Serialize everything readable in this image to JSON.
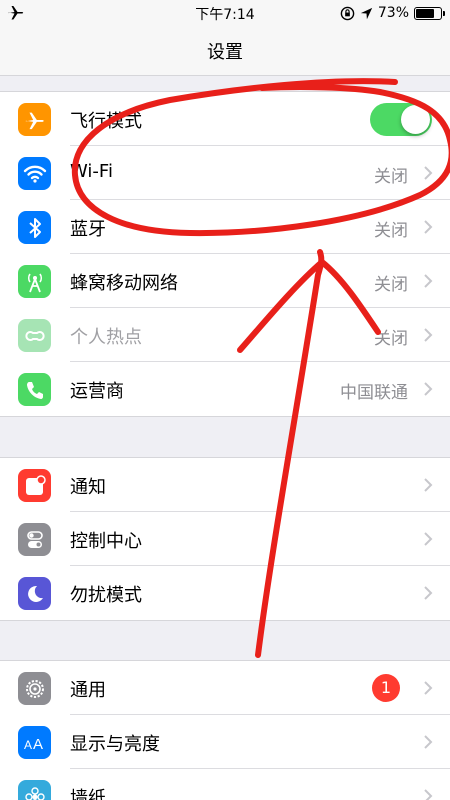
{
  "status_bar": {
    "time": "下午7:14",
    "battery": "73%",
    "battery_level": 0.73
  },
  "nav": {
    "title": "设置"
  },
  "groups": [
    [
      {
        "id": "airplane",
        "label": "飞行模式",
        "icon": "airplane-icon",
        "icon_color": "#ff9500",
        "toggle": true,
        "toggle_on": true
      },
      {
        "id": "wifi",
        "label": "Wi-Fi",
        "icon": "wifi-icon",
        "icon_color": "#007aff",
        "value": "关闭"
      },
      {
        "id": "bluetooth",
        "label": "蓝牙",
        "icon": "bluetooth-icon",
        "icon_color": "#007aff",
        "value": "关闭"
      },
      {
        "id": "cellular",
        "label": "蜂窝移动网络",
        "icon": "cellular-icon",
        "icon_color": "#4cd964",
        "value": "关闭"
      },
      {
        "id": "hotspot",
        "label": "个人热点",
        "icon": "hotspot-icon",
        "icon_color": "#a6e4b4",
        "value": "关闭",
        "disabled": true
      },
      {
        "id": "carrier",
        "label": "运营商",
        "icon": "phone-icon",
        "icon_color": "#4cd964",
        "value": "中国联通"
      }
    ],
    [
      {
        "id": "notifications",
        "label": "通知",
        "icon": "notifications-icon",
        "icon_color": "#ff3b30"
      },
      {
        "id": "control-center",
        "label": "控制中心",
        "icon": "control-center-icon",
        "icon_color": "#8e8e93"
      },
      {
        "id": "do-not-disturb",
        "label": "勿扰模式",
        "icon": "moon-icon",
        "icon_color": "#5856d6"
      }
    ],
    [
      {
        "id": "general",
        "label": "通用",
        "icon": "gear-icon",
        "icon_color": "#8e8e93",
        "badge": "1",
        "badge_color": "#ff3b30"
      },
      {
        "id": "display",
        "label": "显示与亮度",
        "icon": "display-brightness-icon",
        "icon_color": "#007aff"
      },
      {
        "id": "wallpaper",
        "label": "墙纸",
        "icon": "wallpaper-icon",
        "icon_color": "#34aadc"
      }
    ]
  ],
  "annotation_color": "#e8201a"
}
